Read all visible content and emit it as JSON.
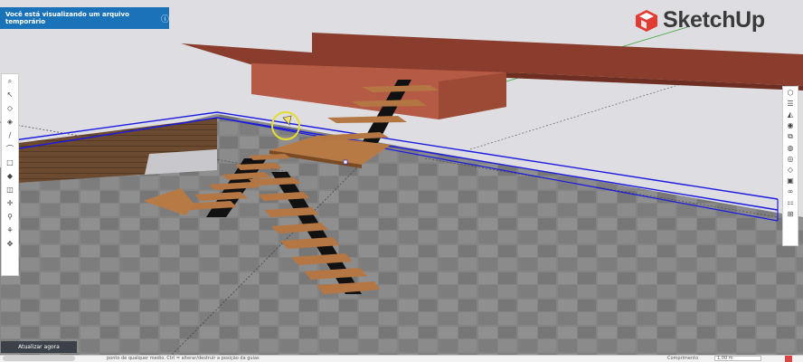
{
  "banner": {
    "text": "Você está visualizando um arquivo temporário",
    "icon": "info-icon"
  },
  "brand": {
    "name": "SketchUp",
    "logo_color": "#e03c31"
  },
  "left_toolbar": {
    "tools": [
      {
        "name": "search-tool",
        "glyph": "⌕"
      },
      {
        "name": "select-tool",
        "glyph": "↖"
      },
      {
        "name": "eraser-tool",
        "glyph": "◇"
      },
      {
        "name": "paint-bucket-tool",
        "glyph": "◈"
      },
      {
        "name": "line-tool",
        "glyph": "/"
      },
      {
        "name": "arc-tool",
        "glyph": "⌒"
      },
      {
        "name": "rectangle-tool",
        "glyph": "□"
      },
      {
        "name": "push-pull-tool",
        "glyph": "◆"
      },
      {
        "name": "offset-tool",
        "glyph": "◫"
      },
      {
        "name": "move-tool",
        "glyph": "✛"
      },
      {
        "name": "tape-measure-tool",
        "glyph": "⚲"
      },
      {
        "name": "walk-tool",
        "glyph": "⚘"
      },
      {
        "name": "orbit-tool",
        "glyph": "✥"
      }
    ]
  },
  "right_toolbar": {
    "tools": [
      {
        "name": "entity-info-panel",
        "glyph": "⬡"
      },
      {
        "name": "layers-panel",
        "glyph": "☰"
      },
      {
        "name": "instructor-panel",
        "glyph": "◭"
      },
      {
        "name": "materials-panel",
        "glyph": "◉"
      },
      {
        "name": "components-panel",
        "glyph": "⧉"
      },
      {
        "name": "styles-panel",
        "glyph": "◍"
      },
      {
        "name": "display-panel",
        "glyph": "◎"
      },
      {
        "name": "tags-panel",
        "glyph": "◇"
      },
      {
        "name": "scenes-panel",
        "glyph": "▣"
      },
      {
        "name": "shadows-panel",
        "glyph": "∞"
      },
      {
        "name": "outliner-panel",
        "glyph": "⚏"
      },
      {
        "name": "export-panel",
        "glyph": "⊞"
      }
    ]
  },
  "update_button": {
    "label": "Atualizar agora"
  },
  "statusbar": {
    "hint": "ponto de qualquer medio. Ctrl = alterar/destruir a posição da guias",
    "measurement_label": "Comprimento",
    "measurement_value": "1,00 m"
  }
}
